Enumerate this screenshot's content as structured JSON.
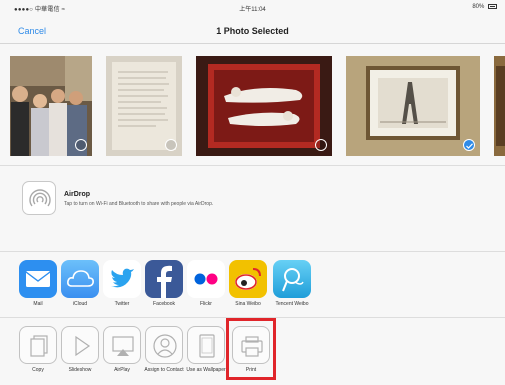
{
  "status_bar": {
    "carrier": "●●●●○ 中華電信 ≈",
    "time": "上午11:04",
    "battery": "80%"
  },
  "nav": {
    "cancel_label": "Cancel",
    "title": "1 Photo Selected"
  },
  "photos": [
    {
      "subject": "group-portrait",
      "selected": false
    },
    {
      "subject": "handwritten-document",
      "selected": false
    },
    {
      "subject": "framed-painting-figures",
      "selected": false
    },
    {
      "subject": "framed-eiffel-tower-drawing",
      "selected": true
    },
    {
      "subject": "partial-photo",
      "selected": false
    }
  ],
  "airdrop": {
    "title": "AirDrop",
    "description": "Tap to turn on Wi-Fi and Bluetooth to share with people via AirDrop."
  },
  "share_apps": [
    {
      "label": "Mail",
      "icon": "mail-icon",
      "color": "#2d8ff0"
    },
    {
      "label": "iCloud",
      "icon": "icloud-icon",
      "color": "#4aa8f5"
    },
    {
      "label": "Twitter",
      "icon": "twitter-icon",
      "color": "#ffffff"
    },
    {
      "label": "Facebook",
      "icon": "facebook-icon",
      "color": "#3b5998"
    },
    {
      "label": "Flickr",
      "icon": "flickr-icon",
      "color": "#ffffff"
    },
    {
      "label": "Sina Weibo",
      "icon": "sina-weibo-icon",
      "color": "#f2c100"
    },
    {
      "label": "Tencent Weibo",
      "icon": "tencent-weibo-icon",
      "color": "#3bb6e8"
    }
  ],
  "actions": [
    {
      "label": "Copy",
      "icon": "copy-icon"
    },
    {
      "label": "Slideshow",
      "icon": "slideshow-icon"
    },
    {
      "label": "AirPlay",
      "icon": "airplay-icon"
    },
    {
      "label": "Assign to Contact",
      "icon": "contact-icon"
    },
    {
      "label": "Use as Wallpaper",
      "icon": "wallpaper-icon"
    },
    {
      "label": "Print",
      "icon": "print-icon",
      "highlighted": true,
      "highlight_color": "#e0252a"
    }
  ]
}
